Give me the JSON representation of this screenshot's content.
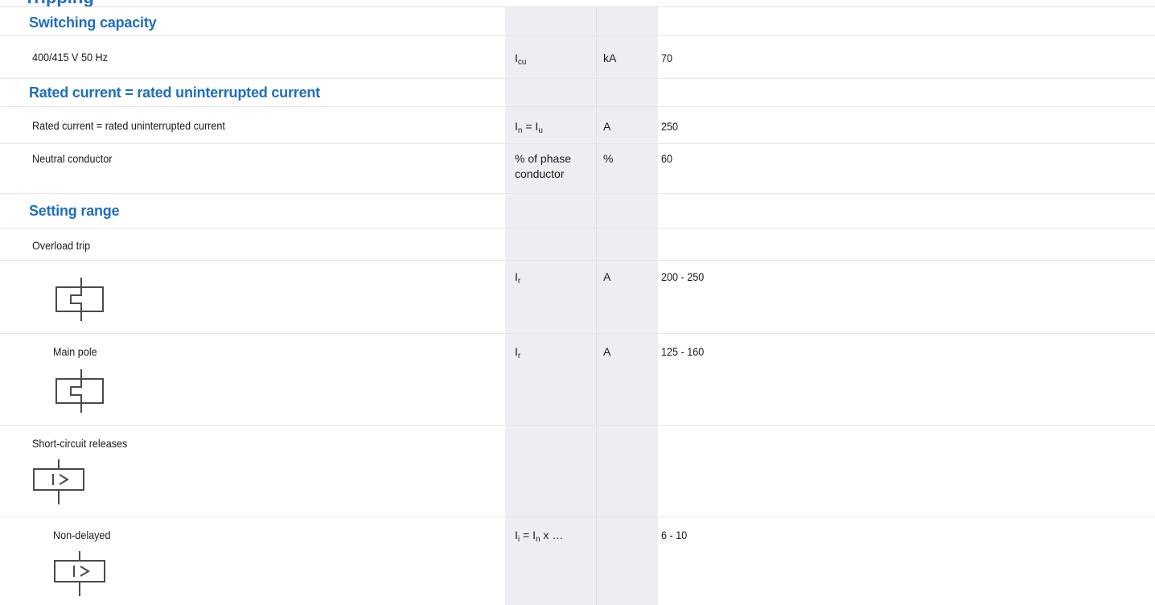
{
  "header": {
    "title_fragment": "Tripping"
  },
  "sections": {
    "switching": "Switching capacity",
    "rated": "Rated current = rated uninterrupted current",
    "setting": "Setting range"
  },
  "rows": {
    "r1": {
      "label": "400/415 V 50 Hz",
      "sym": "I",
      "sym_sub": "cu",
      "unit": "kA",
      "value": "70"
    },
    "r2": {
      "label": "Rated current = rated uninterrupted current",
      "sym_a": "I",
      "sym_a_sub": "n",
      "sym_eq": " = I",
      "sym_b_sub": "u",
      "unit": "A",
      "value": "250"
    },
    "r3": {
      "label": "Neutral conductor",
      "sym_line1": "% of phase",
      "sym_line2": "conductor",
      "unit": "%",
      "value": "60"
    },
    "r4": {
      "label": "Overload trip"
    },
    "r5": {
      "sym": "I",
      "sym_sub": "r",
      "unit": "A",
      "value": "200 - 250"
    },
    "r6": {
      "label": "Main pole",
      "sym": "I",
      "sym_sub": "r",
      "unit": "A",
      "value": "125 - 160"
    },
    "r7": {
      "label": "Short-circuit releases"
    },
    "r8": {
      "label": "Non-delayed",
      "sym_a": "I",
      "sym_a_sub": "i",
      "sym_eq": " = I",
      "sym_b_sub": "n",
      "sym_tail": " x …",
      "unit": "",
      "value": "6 - 10"
    }
  },
  "icons": {
    "overload": "thermal-overload-release-symbol-icon",
    "short_circuit": "short-circuit-release-symbol-icon"
  },
  "colors": {
    "section_heading": "#1d6ebf",
    "symbol_column_bg": "#eceef2"
  }
}
